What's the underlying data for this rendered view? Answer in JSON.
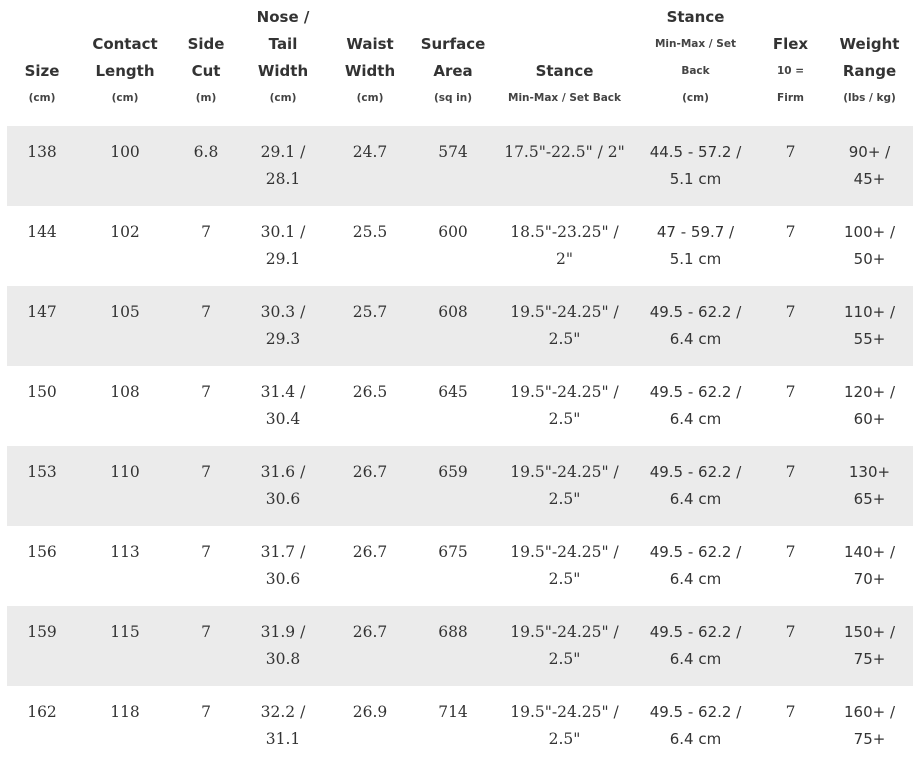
{
  "columns": [
    {
      "key": "size",
      "title_lines": [
        "Size"
      ],
      "unit": "(cm)"
    },
    {
      "key": "contact_length",
      "title_lines": [
        "Contact",
        "Length"
      ],
      "unit": "(cm)"
    },
    {
      "key": "side_cut",
      "title_lines": [
        "Side",
        "Cut"
      ],
      "unit": "(m)"
    },
    {
      "key": "nose_tail_width",
      "title_lines": [
        "Nose /",
        "Tail",
        "Width"
      ],
      "unit": "(cm)"
    },
    {
      "key": "waist_width",
      "title_lines": [
        "Waist",
        "Width"
      ],
      "unit": "(cm)"
    },
    {
      "key": "surface_area",
      "title_lines": [
        "Surface",
        "Area"
      ],
      "unit": "(sq in)"
    },
    {
      "key": "stance_in",
      "title_lines": [
        "Stance"
      ],
      "unit": "Min-Max / Set Back"
    },
    {
      "key": "stance_cm",
      "title_lines": [
        "Stance"
      ],
      "sub_lines": [
        "Min-Max / Set",
        "Back"
      ],
      "unit": "(cm)"
    },
    {
      "key": "flex",
      "title_lines": [
        "Flex"
      ],
      "sub_lines": [
        "10 ="
      ],
      "unit": "Firm"
    },
    {
      "key": "weight_range",
      "title_lines": [
        "Weight",
        "Range"
      ],
      "unit": "(lbs / kg)"
    }
  ],
  "rows": [
    {
      "size": "138",
      "contact_length": "100",
      "side_cut": "6.8",
      "nose_tail_width": [
        "29.1 /",
        "28.1"
      ],
      "waist_width": "24.7",
      "surface_area": "574",
      "stance_in": [
        "17.5\"-22.5\" / 2\""
      ],
      "stance_cm": [
        "44.5 - 57.2 /",
        "5.1 cm"
      ],
      "flex": "7",
      "weight_range": [
        "90+ /",
        "45+"
      ]
    },
    {
      "size": "144",
      "contact_length": "102",
      "side_cut": "7",
      "nose_tail_width": [
        "30.1 /",
        "29.1"
      ],
      "waist_width": "25.5",
      "surface_area": "600",
      "stance_in": [
        "18.5\"-23.25\" /",
        "2\""
      ],
      "stance_cm": [
        "47 - 59.7 /",
        "5.1 cm"
      ],
      "flex": "7",
      "weight_range": [
        "100+ /",
        "50+"
      ]
    },
    {
      "size": "147",
      "contact_length": "105",
      "side_cut": "7",
      "nose_tail_width": [
        "30.3 /",
        "29.3"
      ],
      "waist_width": "25.7",
      "surface_area": "608",
      "stance_in": [
        "19.5\"-24.25\" /",
        "2.5\""
      ],
      "stance_cm": [
        "49.5 - 62.2 /",
        "6.4 cm"
      ],
      "flex": "7",
      "weight_range": [
        "110+ /",
        "55+"
      ]
    },
    {
      "size": "150",
      "contact_length": "108",
      "side_cut": "7",
      "nose_tail_width": [
        "31.4 /",
        "30.4"
      ],
      "waist_width": "26.5",
      "surface_area": "645",
      "stance_in": [
        "19.5\"-24.25\" /",
        "2.5\""
      ],
      "stance_cm": [
        "49.5 - 62.2 /",
        "6.4 cm"
      ],
      "flex": "7",
      "weight_range": [
        "120+ /",
        "60+"
      ]
    },
    {
      "size": "153",
      "contact_length": "110",
      "side_cut": "7",
      "nose_tail_width": [
        "31.6 /",
        "30.6"
      ],
      "waist_width": "26.7",
      "surface_area": "659",
      "stance_in": [
        "19.5\"-24.25\" /",
        "2.5\""
      ],
      "stance_cm": [
        "49.5 - 62.2 /",
        "6.4 cm"
      ],
      "flex": "7",
      "weight_range": [
        "130+",
        "65+"
      ]
    },
    {
      "size": "156",
      "contact_length": "113",
      "side_cut": "7",
      "nose_tail_width": [
        "31.7 /",
        "30.6"
      ],
      "waist_width": "26.7",
      "surface_area": "675",
      "stance_in": [
        "19.5\"-24.25\" /",
        "2.5\""
      ],
      "stance_cm": [
        "49.5 - 62.2 /",
        "6.4 cm"
      ],
      "flex": "7",
      "weight_range": [
        "140+ /",
        "70+"
      ]
    },
    {
      "size": "159",
      "contact_length": "115",
      "side_cut": "7",
      "nose_tail_width": [
        "31.9 /",
        "30.8"
      ],
      "waist_width": "26.7",
      "surface_area": "688",
      "stance_in": [
        "19.5\"-24.25\" /",
        "2.5\""
      ],
      "stance_cm": [
        "49.5 - 62.2 /",
        "6.4 cm"
      ],
      "flex": "7",
      "weight_range": [
        "150+ /",
        "75+"
      ]
    },
    {
      "size": "162",
      "contact_length": "118",
      "side_cut": "7",
      "nose_tail_width": [
        "32.2 /",
        "31.1"
      ],
      "waist_width": "26.9",
      "surface_area": "714",
      "stance_in": [
        "19.5\"-24.25\" /",
        "2.5\""
      ],
      "stance_cm": [
        "49.5 - 62.2 /",
        "6.4 cm"
      ],
      "flex": "7",
      "weight_range": [
        "160+ /",
        "75+"
      ]
    }
  ],
  "colors": {
    "shaded_row": "#ebebeb",
    "text": "#333333",
    "background": "#ffffff"
  }
}
